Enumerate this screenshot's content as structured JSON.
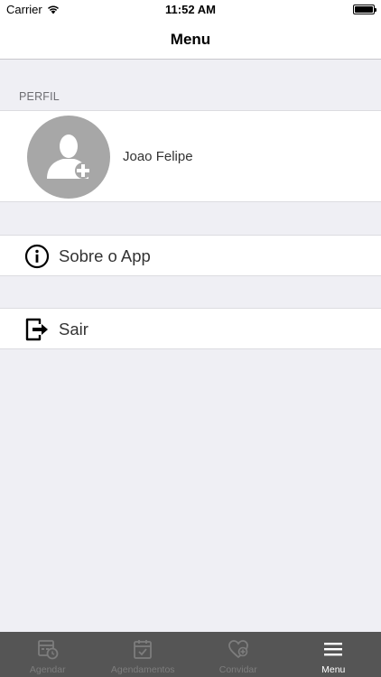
{
  "status_bar": {
    "carrier": "Carrier",
    "time": "11:52 AM"
  },
  "nav": {
    "title": "Menu"
  },
  "profile": {
    "section_header": "PERFIL",
    "name": "Joao Felipe"
  },
  "menu": {
    "items": [
      {
        "label": "Sobre o App",
        "icon": "info-icon"
      },
      {
        "label": "Sair",
        "icon": "logout-icon"
      }
    ]
  },
  "tab_bar": {
    "items": [
      {
        "label": "Agendar",
        "icon": "calendar-clock-icon",
        "active": false
      },
      {
        "label": "Agendamentos",
        "icon": "calendar-check-icon",
        "active": false
      },
      {
        "label": "Convidar",
        "icon": "heart-add-icon",
        "active": false
      },
      {
        "label": "Menu",
        "icon": "hamburger-icon",
        "active": true
      }
    ],
    "active_color": "#ffffff",
    "inactive_color": "#7d7d7d",
    "background": "#555555"
  }
}
